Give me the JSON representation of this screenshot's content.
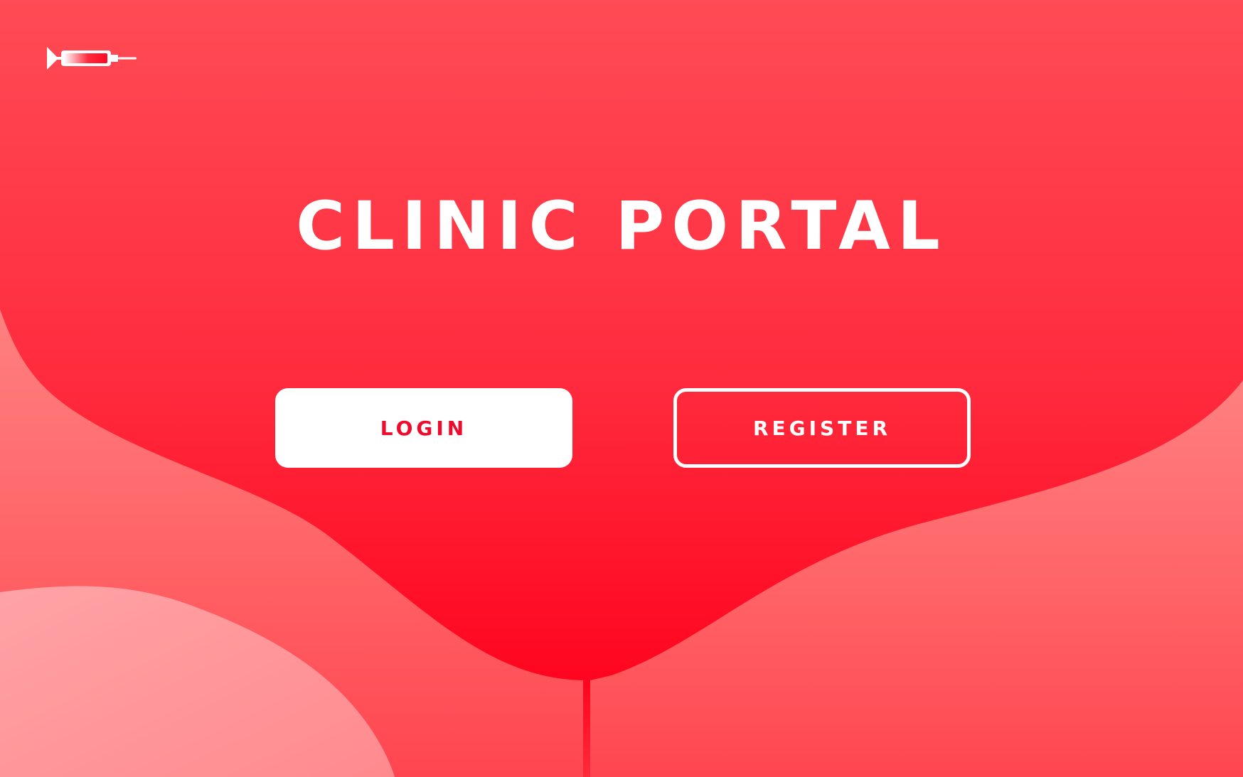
{
  "page": {
    "title": "CLINIC PORTAL"
  },
  "logo": {
    "icon": "syringe-icon"
  },
  "buttons": {
    "login_label": "LOGIN",
    "register_label": "REGISTER"
  },
  "colors": {
    "background_top": "#ff4b55",
    "background_center": "#ff0a23",
    "wave_light": "#ff7479",
    "wave_lightest": "#ff9ca0",
    "accent_text": "#ee0b2c",
    "white": "#ffffff"
  }
}
